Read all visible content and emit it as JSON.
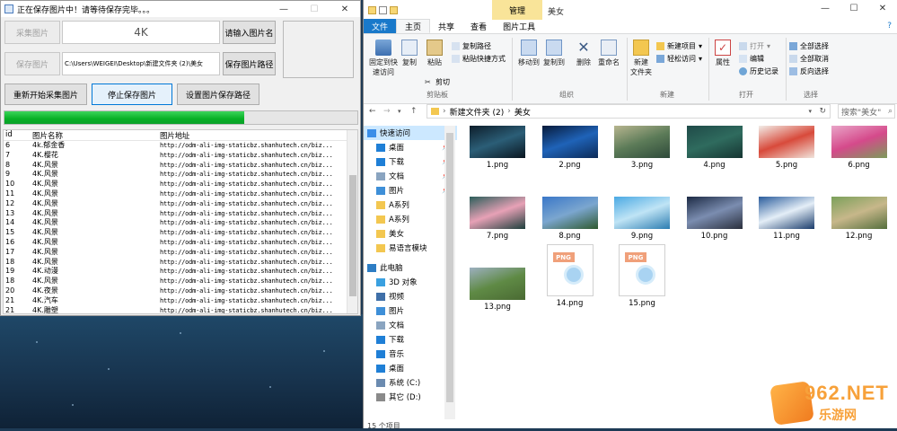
{
  "app": {
    "title": "正在保存图片中！请等待保存完毕。。。",
    "buttons": {
      "collect": "采集图片",
      "enter_name": "请输入图片名",
      "save_img": "保存图片",
      "save_path": "保存图片路径",
      "restart": "重新开始采集图片",
      "stop": "停止保存图片",
      "set_path": "设置图片保存路径"
    },
    "name_value": "4K",
    "path_value": "C:\\Users\\WEIGEI\\Desktop\\新建文件夹 (2)\\美女",
    "progress_percent": 68,
    "list_headers": [
      "id",
      "图片名称",
      "图片地址"
    ],
    "list_rows": [
      {
        "id": "6",
        "name": "4k.郁金香",
        "url": "http://odm-ali-img-staticbz.shanhutech.cn/biz..."
      },
      {
        "id": "7",
        "name": "4K.樱花",
        "url": "http://odm-ali-img-staticbz.shanhutech.cn/biz..."
      },
      {
        "id": "8",
        "name": "4K.风景",
        "url": "http://odm-ali-img-staticbz.shanhutech.cn/biz..."
      },
      {
        "id": "9",
        "name": "4K.风景",
        "url": "http://odm-ali-img-staticbz.shanhutech.cn/biz..."
      },
      {
        "id": "10",
        "name": "4K.风景",
        "url": "http://odm-ali-img-staticbz.shanhutech.cn/biz..."
      },
      {
        "id": "11",
        "name": "4K.风景",
        "url": "http://odm-ali-img-staticbz.shanhutech.cn/biz..."
      },
      {
        "id": "12",
        "name": "4K.风景",
        "url": "http://odm-ali-img-staticbz.shanhutech.cn/biz..."
      },
      {
        "id": "13",
        "name": "4K.风景",
        "url": "http://odm-ali-img-staticbz.shanhutech.cn/biz..."
      },
      {
        "id": "14",
        "name": "4K.风景",
        "url": "http://odm-ali-img-staticbz.shanhutech.cn/biz..."
      },
      {
        "id": "15",
        "name": "4K.风景",
        "url": "http://odm-ali-img-staticbz.shanhutech.cn/biz..."
      },
      {
        "id": "16",
        "name": "4K.风景",
        "url": "http://odm-ali-img-staticbz.shanhutech.cn/biz..."
      },
      {
        "id": "17",
        "name": "4K.风景",
        "url": "http://odm-ali-img-staticbz.shanhutech.cn/biz..."
      },
      {
        "id": "18",
        "name": "4K.风景",
        "url": "http://odm-ali-img-staticbz.shanhutech.cn/biz..."
      },
      {
        "id": "19",
        "name": "4K.动漫",
        "url": "http://odm-ali-img-staticbz.shanhutech.cn/biz..."
      },
      {
        "id": "18",
        "name": "4K.风景",
        "url": "http://odm-ali-img-staticbz.shanhutech.cn/biz..."
      },
      {
        "id": "20",
        "name": "4K.夜景",
        "url": "http://odm-ali-img-staticbz.shanhutech.cn/biz..."
      },
      {
        "id": "21",
        "name": "4K.汽车",
        "url": "http://odm-ali-img-staticbz.shanhutech.cn/biz..."
      },
      {
        "id": "21",
        "name": "4K.雕塑",
        "url": "http://odm-ali-img-staticbz.shanhutech.cn/biz..."
      },
      {
        "id": "22",
        "name": "4K.风景",
        "url": "http://odm-ali-img-staticbz.shanhutech.cn/biz..."
      }
    ]
  },
  "explorer": {
    "manage_tab": "管理",
    "folder_name": "美女",
    "tabs": [
      "文件",
      "主页",
      "共享",
      "查看",
      "图片工具"
    ],
    "ribbon": {
      "pin": "固定到快\n速访问",
      "copy": "复制",
      "paste": "粘贴",
      "cut": "剪切",
      "copy_path": "复制路径",
      "paste_shortcut": "粘贴快捷方式",
      "move_to": "移动到",
      "copy_to": "复制到",
      "delete": "删除",
      "rename": "重命名",
      "new_folder": "新建\n文件夹",
      "new_item": "新建项目",
      "easy_access": "轻松访问",
      "properties": "属性",
      "open": "打开",
      "edit": "编辑",
      "history": "历史记录",
      "select_all": "全部选择",
      "select_none": "全部取消",
      "invert": "反向选择",
      "groups": [
        "剪贴板",
        "组织",
        "新建",
        "打开",
        "选择"
      ]
    },
    "breadcrumb": [
      "新建文件夹 (2)",
      "美女"
    ],
    "search_placeholder": "搜索\"美女\"",
    "nav": [
      {
        "label": "快速访问",
        "icon": "star-icon",
        "color": "#3b8ee8",
        "sel": true,
        "pin": false
      },
      {
        "label": "桌面",
        "icon": "desktop-icon",
        "color": "#1f7fd6",
        "sel": false,
        "pin": true
      },
      {
        "label": "下载",
        "icon": "download-icon",
        "color": "#1f7fd6",
        "sel": false,
        "pin": true
      },
      {
        "label": "文档",
        "icon": "document-icon",
        "color": "#8aa4c0",
        "sel": false,
        "pin": true
      },
      {
        "label": "图片",
        "icon": "pictures-icon",
        "color": "#3e8fd8",
        "sel": false,
        "pin": true
      },
      {
        "label": "A系列",
        "icon": "folder-icon",
        "color": "#f3c750",
        "sel": false,
        "pin": false
      },
      {
        "label": "A系列",
        "icon": "folder-icon",
        "color": "#f3c750",
        "sel": false,
        "pin": false
      },
      {
        "label": "美女",
        "icon": "folder-icon",
        "color": "#f3c750",
        "sel": false,
        "pin": false
      },
      {
        "label": "易语言模块",
        "icon": "folder-icon",
        "color": "#f3c750",
        "sel": false,
        "pin": false
      },
      {
        "label": "此电脑",
        "icon": "computer-icon",
        "color": "#2d7dc4",
        "sel": false,
        "pin": false
      },
      {
        "label": "3D 对象",
        "icon": "cube-icon",
        "color": "#3aa0e0",
        "sel": false,
        "pin": false
      },
      {
        "label": "视频",
        "icon": "video-icon",
        "color": "#3f6fa8",
        "sel": false,
        "pin": false
      },
      {
        "label": "图片",
        "icon": "pictures-icon",
        "color": "#3e8fd8",
        "sel": false,
        "pin": false
      },
      {
        "label": "文档",
        "icon": "document-icon",
        "color": "#8aa4c0",
        "sel": false,
        "pin": false
      },
      {
        "label": "下载",
        "icon": "download-icon",
        "color": "#1f7fd6",
        "sel": false,
        "pin": false
      },
      {
        "label": "音乐",
        "icon": "music-icon",
        "color": "#1f7fd6",
        "sel": false,
        "pin": false
      },
      {
        "label": "桌面",
        "icon": "desktop-icon",
        "color": "#1f7fd6",
        "sel": false,
        "pin": false
      },
      {
        "label": "系统 (C:)",
        "icon": "drive-icon",
        "color": "#6b8bb0",
        "sel": false,
        "pin": false
      },
      {
        "label": "其它 (D:)",
        "icon": "drive-icon",
        "color": "#8a8a8a",
        "sel": false,
        "pin": false
      }
    ],
    "files": [
      {
        "name": "1.png",
        "kind": "img",
        "colors": [
          "#0d1d2a",
          "#2b5e77",
          "#0a1620"
        ]
      },
      {
        "name": "2.png",
        "kind": "img",
        "colors": [
          "#071a3a",
          "#1f63b8",
          "#0c2a57"
        ]
      },
      {
        "name": "3.png",
        "kind": "img",
        "colors": [
          "#b7b58f",
          "#5c7b58",
          "#2e4a3a"
        ]
      },
      {
        "name": "4.png",
        "kind": "img",
        "colors": [
          "#1f4a48",
          "#2f6b5e",
          "#163532"
        ]
      },
      {
        "name": "5.png",
        "kind": "img",
        "colors": [
          "#f2ede8",
          "#d84a3b",
          "#f0e4dc"
        ]
      },
      {
        "name": "6.png",
        "kind": "img",
        "colors": [
          "#e9a5c8",
          "#d54a8b",
          "#7c9c5a"
        ]
      },
      {
        "name": "7.png",
        "kind": "img",
        "colors": [
          "#2b5e5a",
          "#e7a1b6",
          "#1d3f3c"
        ]
      },
      {
        "name": "8.png",
        "kind": "img",
        "colors": [
          "#3a77c8",
          "#7ba6cf",
          "#2f5a2f"
        ]
      },
      {
        "name": "9.png",
        "kind": "img",
        "colors": [
          "#4aa9e3",
          "#bfe4f5",
          "#2c7db1"
        ]
      },
      {
        "name": "10.png",
        "kind": "img",
        "colors": [
          "#1c2a44",
          "#7b8db0",
          "#2a2f3c"
        ]
      },
      {
        "name": "11.png",
        "kind": "img",
        "colors": [
          "#2a5c9c",
          "#e4eef7",
          "#1a3c6b"
        ]
      },
      {
        "name": "12.png",
        "kind": "img",
        "colors": [
          "#7ba05a",
          "#c7b78a",
          "#556f3d"
        ]
      },
      {
        "name": "13.png",
        "kind": "img",
        "colors": [
          "#9db0c0",
          "#5f8a45",
          "#4a6a33"
        ]
      },
      {
        "name": "14.png",
        "kind": "doc",
        "tag": "PNG",
        "colors": []
      },
      {
        "name": "15.png",
        "kind": "doc",
        "tag": "PNG",
        "colors": []
      }
    ],
    "status": "15 个项目"
  },
  "watermark": {
    "num": "962.NET",
    "sub": "乐游网"
  }
}
